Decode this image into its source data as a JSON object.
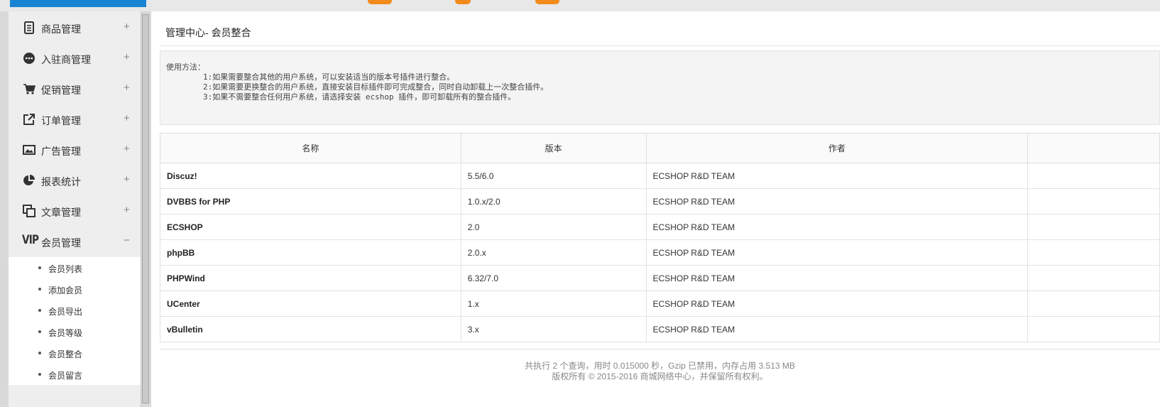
{
  "colors": {
    "accent": "#1a84d4",
    "badge": "#f28a1c",
    "sidebar_bg": "#eeeeee"
  },
  "sidebar": {
    "items": [
      {
        "label": "商品管理",
        "toggle": "+",
        "icon": "goods-document-icon"
      },
      {
        "label": "入驻商管理",
        "toggle": "+",
        "icon": "chat-bubble-icon"
      },
      {
        "label": "促销管理",
        "toggle": "+",
        "icon": "shopping-cart-icon"
      },
      {
        "label": "订单管理",
        "toggle": "+",
        "icon": "external-link-icon"
      },
      {
        "label": "广告管理",
        "toggle": "+",
        "icon": "picture-icon"
      },
      {
        "label": "报表统计",
        "toggle": "+",
        "icon": "pie-chart-icon"
      },
      {
        "label": "文章管理",
        "toggle": "+",
        "icon": "copy-pages-icon"
      },
      {
        "label": "会员管理",
        "toggle": "−",
        "icon": "vip-icon",
        "icon_text": "VIP"
      }
    ],
    "sub_items": [
      {
        "label": "会员列表"
      },
      {
        "label": "添加会员"
      },
      {
        "label": "会员导出"
      },
      {
        "label": "会员等级"
      },
      {
        "label": "会员整合"
      },
      {
        "label": "会员留言"
      }
    ]
  },
  "main": {
    "title": "管理中心- 会员整合",
    "usage": {
      "heading": "使用方法：",
      "lines": [
        "1:如果需要整合其他的用户系统，可以安装适当的版本号插件进行整合。",
        "2:如果需要更换整合的用户系统，直接安装目标插件即可完成整合，同时自动卸载上一次整合插件。",
        "3:如果不需要整合任何用户系统，请选择安装 ecshop 插件，即可卸载所有的整合插件。"
      ]
    },
    "table": {
      "headers": [
        "名称",
        "版本",
        "作者",
        ""
      ],
      "rows": [
        {
          "name": "Discuz!",
          "version": "5.5/6.0",
          "author": "ECSHOP R&D TEAM"
        },
        {
          "name": "DVBBS for PHP",
          "version": "1.0.x/2.0",
          "author": "ECSHOP R&D TEAM"
        },
        {
          "name": "ECSHOP",
          "version": "2.0",
          "author": "ECSHOP R&D TEAM"
        },
        {
          "name": "phpBB",
          "version": "2.0.x",
          "author": "ECSHOP R&D TEAM"
        },
        {
          "name": "PHPWind",
          "version": "6.32/7.0",
          "author": "ECSHOP R&D TEAM"
        },
        {
          "name": "UCenter",
          "version": "1.x",
          "author": "ECSHOP R&D TEAM"
        },
        {
          "name": "vBulletin",
          "version": "3.x",
          "author": "ECSHOP R&D TEAM"
        }
      ]
    },
    "footer": {
      "line1": "共执行 2 个查询，用时 0.015000 秒，Gzip 已禁用，内存占用 3.513 MB",
      "line2": "版权所有 © 2015-2016 商城网络中心，并保留所有权利。"
    }
  }
}
